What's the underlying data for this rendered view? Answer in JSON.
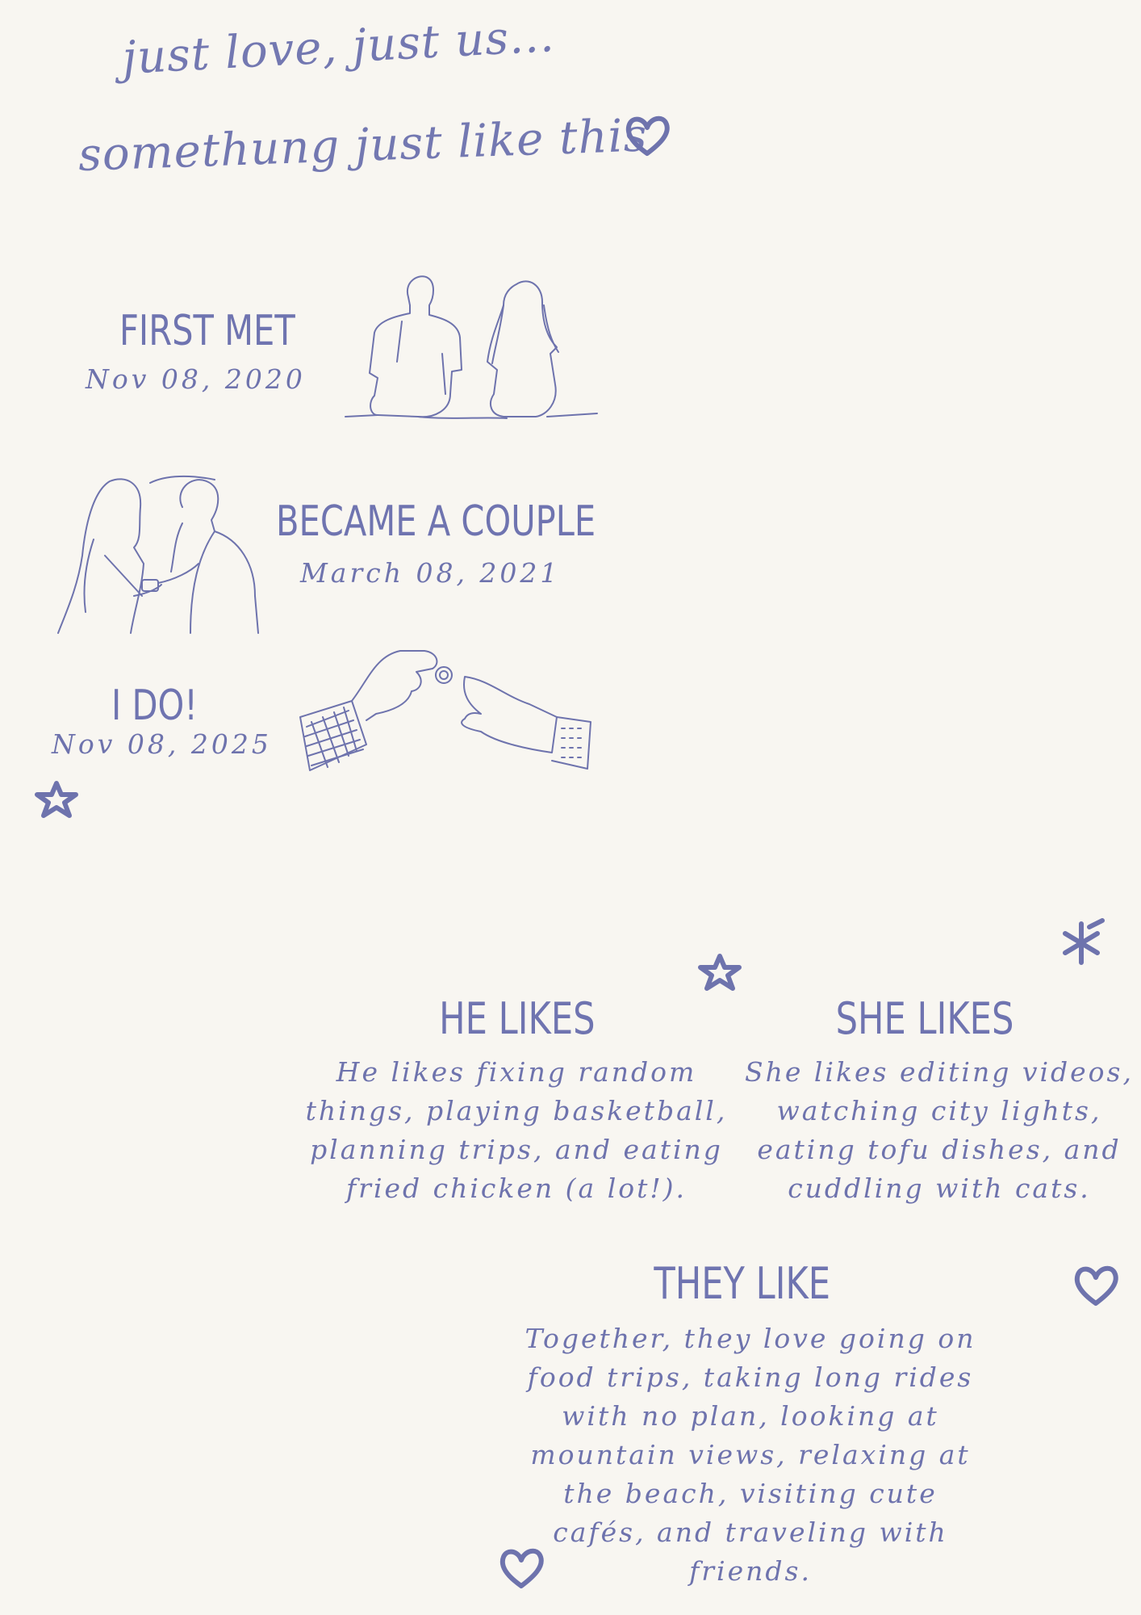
{
  "header": {
    "line1": "just love, just us...",
    "line2": "somethung just like this"
  },
  "timeline": [
    {
      "label": "FIRST MET",
      "date": "Nov 08, 2020"
    },
    {
      "label": "BECAME A COUPLE",
      "date": "March 08, 2021"
    },
    {
      "label": "I DO!",
      "date": "Nov 08, 2025"
    }
  ],
  "he_likes": {
    "title": "HE LIKES",
    "text": "He likes fixing random things, playing basketball, planning trips, and eating fried chicken (a lot!)."
  },
  "she_likes": {
    "title": "SHE LIKES",
    "text": "She likes editing videos, watching city lights, eating tofu dishes, and cuddling with cats."
  },
  "they_like": {
    "title": "THEY LIKE",
    "text": "Together, they love going on food trips, taking long rides with no plan, looking at mountain views, relaxing at the beach, visiting cute cafés, and traveling with friends."
  },
  "colors": {
    "ink": "#6e73ad",
    "paper": "#f8f6f1"
  },
  "icons": [
    "heart-icon",
    "star-icon",
    "asterisk-icon"
  ]
}
